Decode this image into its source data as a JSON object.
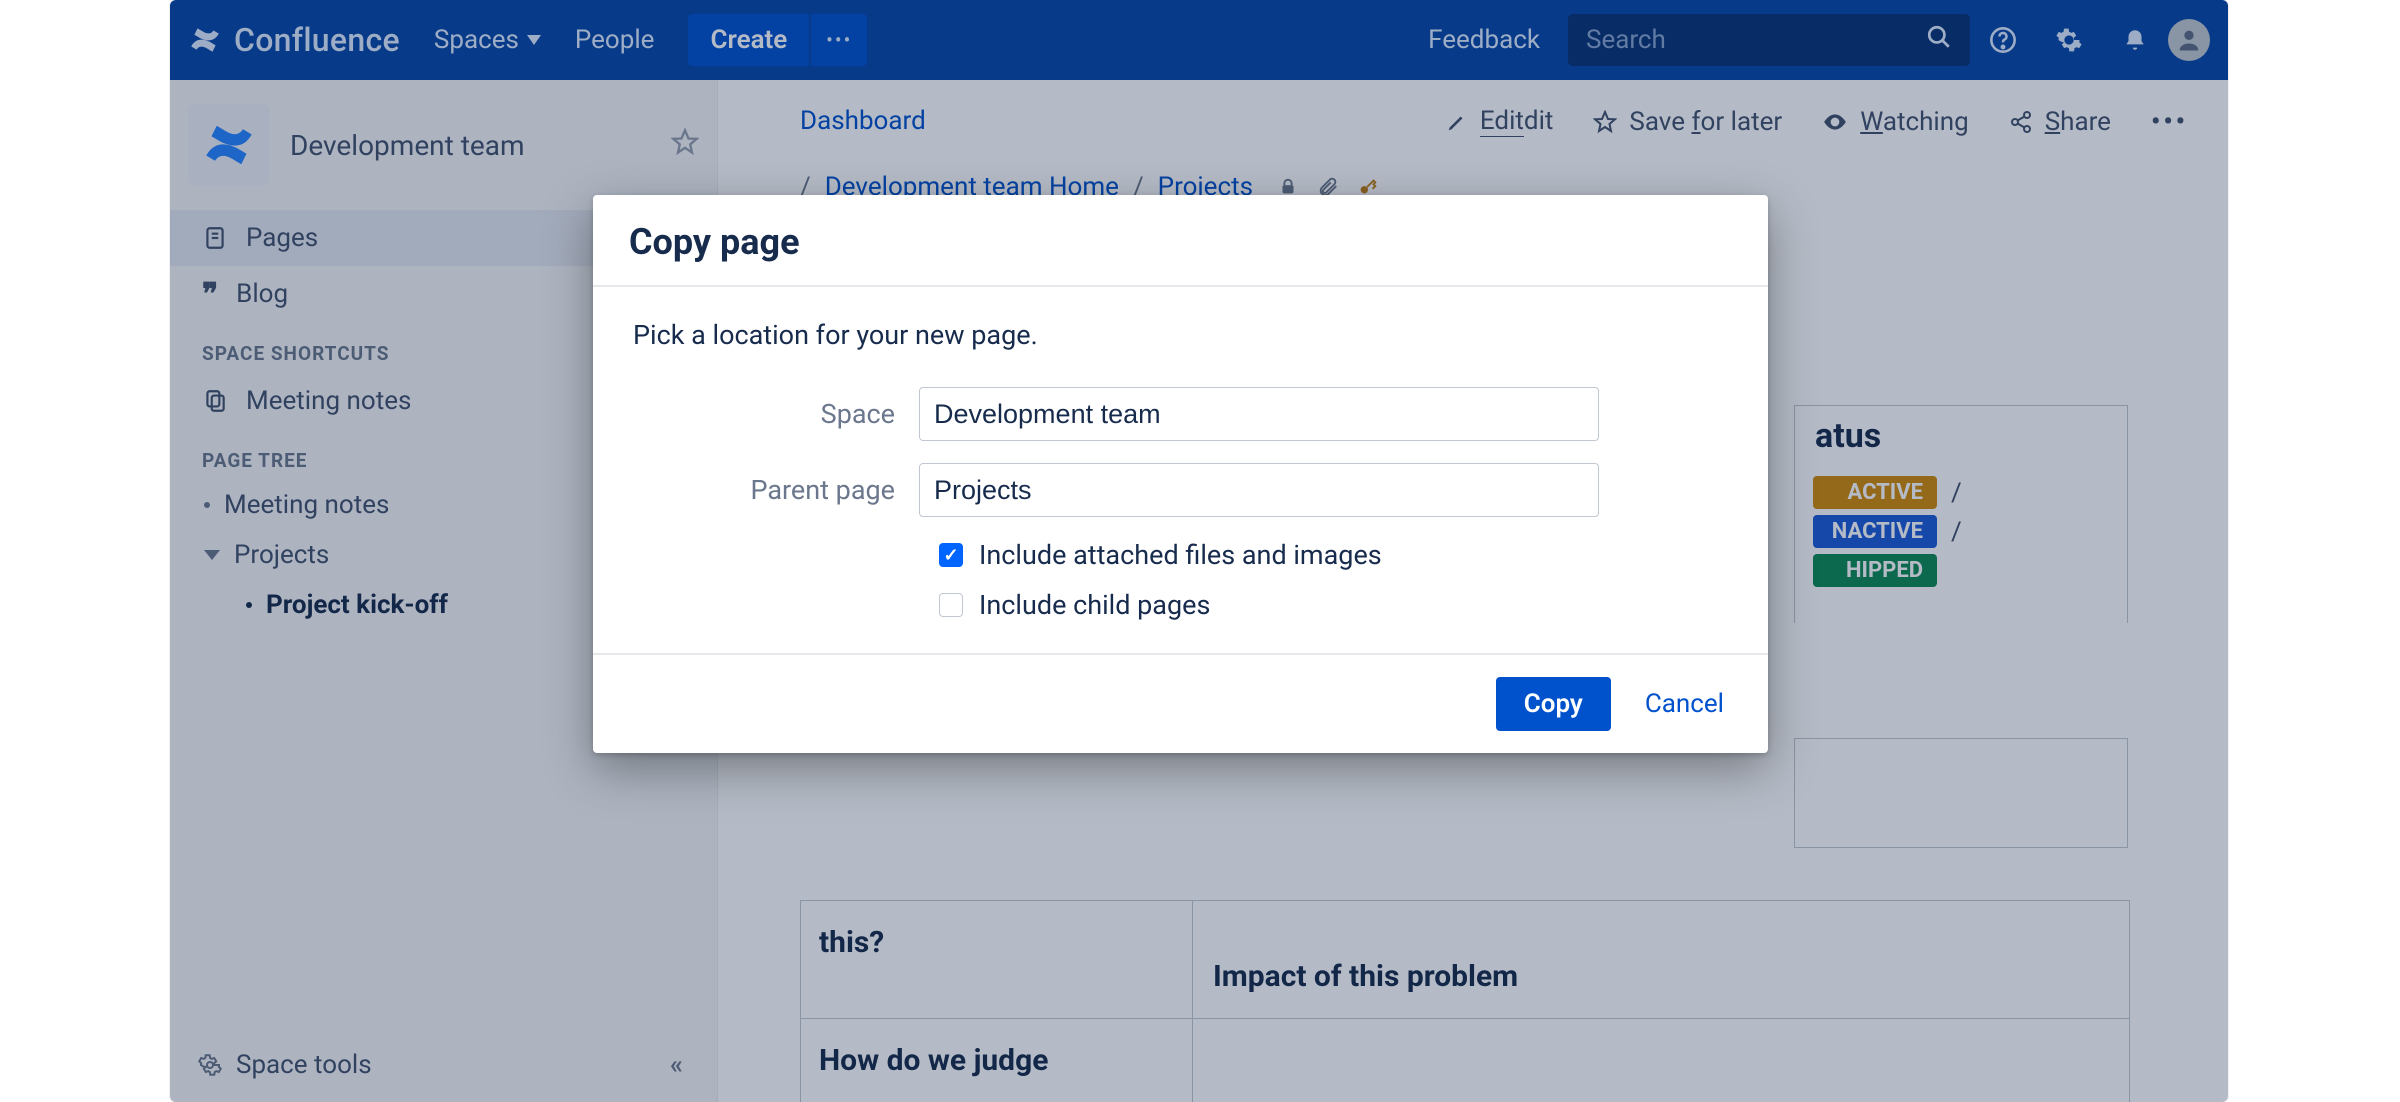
{
  "header": {
    "product": "Confluence",
    "spaces": "Spaces",
    "people": "People",
    "create": "Create",
    "feedback": "Feedback",
    "search_placeholder": "Search"
  },
  "sidebar": {
    "space_name": "Development team",
    "pages": "Pages",
    "blog": "Blog",
    "section_shortcuts": "SPACE SHORTCUTS",
    "meeting_notes": "Meeting notes",
    "section_tree": "PAGE TREE",
    "tree": {
      "meeting_notes": "Meeting notes",
      "projects": "Projects",
      "project_kickoff": "Project kick-off"
    },
    "space_tools": "Space tools"
  },
  "breadcrumbs": {
    "dashboard": "Dashboard",
    "home": "Development team Home",
    "projects": "Projects"
  },
  "toolbar": {
    "edit": "Edit",
    "save": "Save for later",
    "watching": "Watching",
    "share": "Share"
  },
  "status_panel": {
    "title_fragment": "atus",
    "active": "ACTIVE",
    "inactive": "NACTIVE",
    "shipped": "HIPPED"
  },
  "table": {
    "row1_left": "this?",
    "row1_right": "Impact of this problem",
    "row2_left": "How do we judge"
  },
  "modal": {
    "title": "Copy page",
    "instruction": "Pick a location for your new page.",
    "label_space": "Space",
    "value_space": "Development team",
    "label_parent": "Parent page",
    "value_parent": "Projects",
    "chk_attach": "Include attached files and images",
    "chk_children": "Include child pages",
    "btn_copy": "Copy",
    "btn_cancel": "Cancel"
  }
}
